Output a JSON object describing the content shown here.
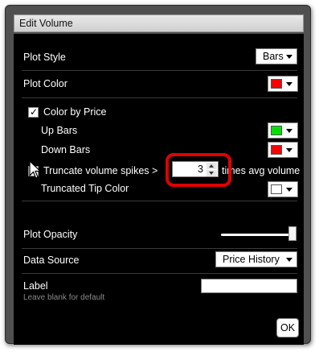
{
  "window": {
    "title": "Edit Volume"
  },
  "plot_style": {
    "label": "Plot Style",
    "value": "Bars"
  },
  "plot_color": {
    "label": "Plot Color",
    "color": "#ff0000"
  },
  "color_by_price": {
    "label": "Color by Price",
    "checked": true
  },
  "up_bars": {
    "label": "Up Bars",
    "color": "#00e000"
  },
  "down_bars": {
    "label": "Down Bars",
    "color": "#ff0000"
  },
  "truncate": {
    "label": "Truncate volume spikes >",
    "value": "3",
    "suffix": "times avg volume",
    "checked": true
  },
  "tip_color": {
    "label": "Truncated Tip Color",
    "color": "#ffffff"
  },
  "opacity": {
    "label": "Plot Opacity",
    "level": 1.0
  },
  "data_source": {
    "label": "Data Source",
    "value": "Price History"
  },
  "label_field": {
    "label": "Label",
    "hint": "Leave blank for default",
    "value": ""
  },
  "ok_button": {
    "label": "OK"
  }
}
